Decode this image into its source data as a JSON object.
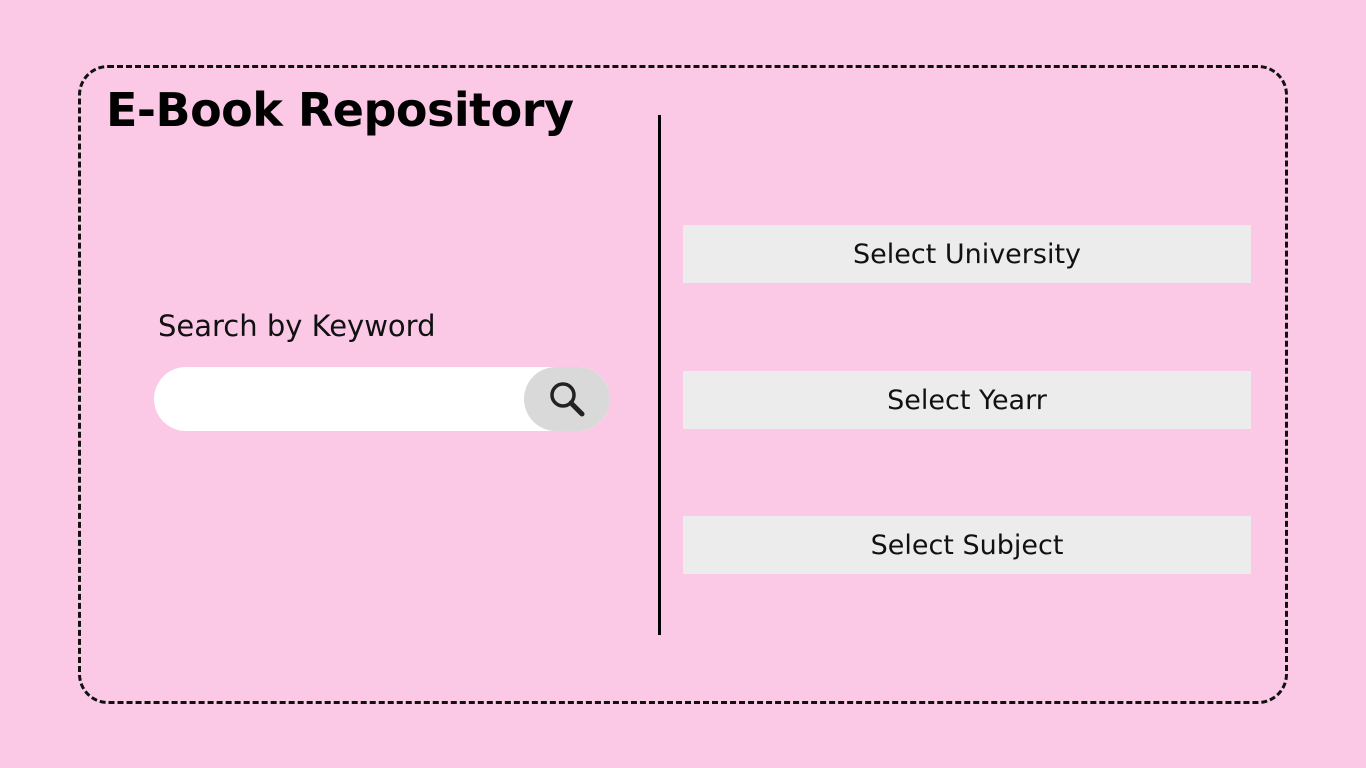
{
  "header": {
    "title": "E-Book Repository"
  },
  "search": {
    "label": "Search by Keyword",
    "value": "",
    "placeholder": "",
    "button_icon": "search-icon"
  },
  "filters": [
    {
      "label": "Select University"
    },
    {
      "label": "Select Yearr"
    },
    {
      "label": "Select Subject"
    }
  ],
  "colors": {
    "background": "#fbc8e6",
    "search_field": "#ffffff",
    "search_button": "#d9d9d9",
    "select_box": "#ececec",
    "border": "#111111"
  }
}
